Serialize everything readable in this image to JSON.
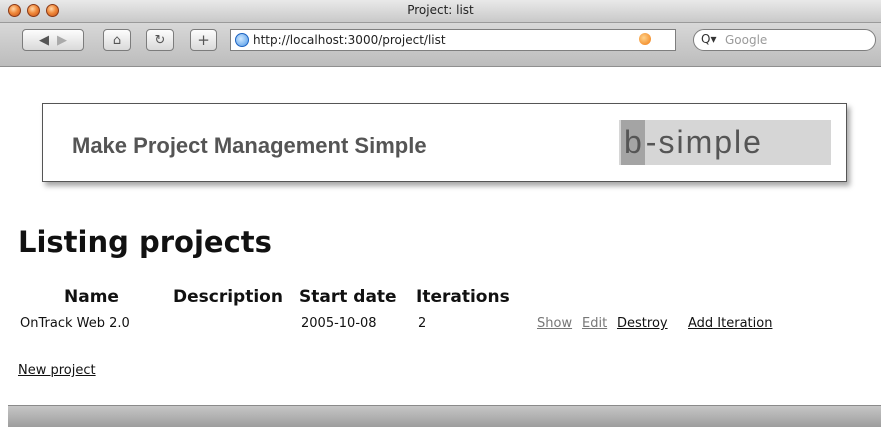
{
  "window": {
    "title": "Project: list"
  },
  "toolbar": {
    "back_icon": "back-arrow-icon",
    "forward_icon": "forward-arrow-icon",
    "home_icon": "home-icon",
    "reload_icon": "reload-icon",
    "add_icon": "plus-icon",
    "url": "http://localhost:3000/project/list",
    "search_placeholder": "Google"
  },
  "banner": {
    "tagline": "Make Project Management Simple",
    "logo_highlight": "b",
    "logo_rest": "-simple"
  },
  "page": {
    "heading": "Listing projects",
    "table": {
      "headers": [
        "Name",
        "Description",
        "Start date",
        "Iterations"
      ],
      "rows": [
        {
          "name": "OnTrack Web 2.0",
          "description": "",
          "start_date": "2005-10-08",
          "iterations": "2",
          "actions": [
            "Show",
            "Edit",
            "Destroy",
            "Add Iteration"
          ]
        }
      ]
    },
    "new_link": "New project"
  },
  "colors": {
    "visited_link": "#777777",
    "link": "#111111"
  }
}
